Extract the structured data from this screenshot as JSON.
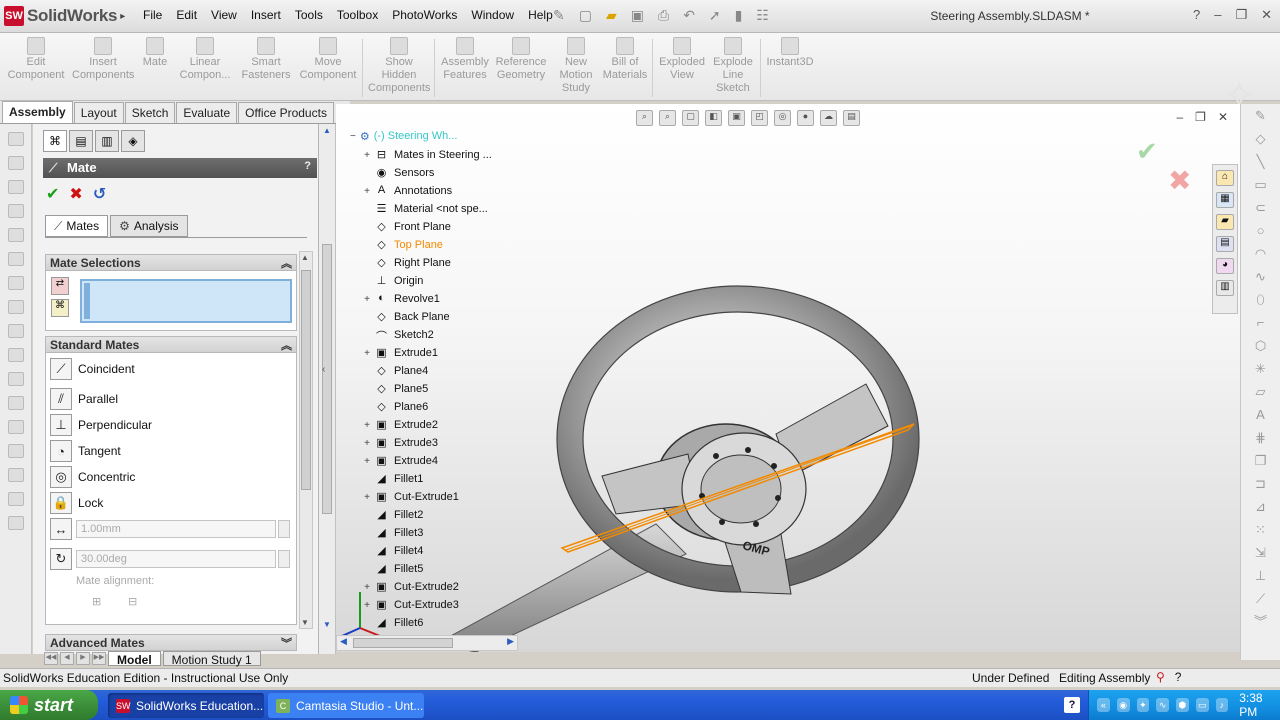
{
  "app": {
    "logo_text": "SolidWorks",
    "document_title": "Steering Assembly.SLDASM *"
  },
  "menu": [
    "File",
    "Edit",
    "View",
    "Insert",
    "Tools",
    "Toolbox",
    "PhotoWorks",
    "Window",
    "Help"
  ],
  "command_manager": [
    {
      "label": "Edit Component",
      "icon": "edit-component-icon"
    },
    {
      "label": "Insert Components",
      "icon": "insert-components-icon"
    },
    {
      "label": "Mate",
      "icon": "mate-icon"
    },
    {
      "label": "Linear Compon...",
      "icon": "linear-pattern-icon"
    },
    {
      "label": "Smart Fasteners",
      "icon": "smart-fasteners-icon"
    },
    {
      "label": "Move Component",
      "icon": "move-component-icon"
    },
    {
      "label": "Show Hidden Components",
      "icon": "show-hidden-icon"
    },
    {
      "label": "Assembly Features",
      "icon": "assembly-features-icon"
    },
    {
      "label": "Reference Geometry",
      "icon": "reference-geometry-icon"
    },
    {
      "label": "New Motion Study",
      "icon": "motion-study-icon"
    },
    {
      "label": "Bill of Materials",
      "icon": "bom-icon"
    },
    {
      "label": "Exploded View",
      "icon": "exploded-view-icon"
    },
    {
      "label": "Explode Line Sketch",
      "icon": "explode-line-icon"
    },
    {
      "label": "Instant3D",
      "icon": "instant3d-icon"
    }
  ],
  "cm_tabs": [
    {
      "label": "Assembly",
      "active": true
    },
    {
      "label": "Layout",
      "active": false
    },
    {
      "label": "Sketch",
      "active": false
    },
    {
      "label": "Evaluate",
      "active": false
    },
    {
      "label": "Office Products",
      "active": false
    }
  ],
  "property_manager": {
    "title": "Mate",
    "help_glyph": "?",
    "tabs": [
      {
        "label": "Mates",
        "icon": "mates-icon",
        "active": true
      },
      {
        "label": "Analysis",
        "icon": "analysis-icon",
        "active": false
      }
    ],
    "mate_selections_label": "Mate Selections",
    "standard_mates_label": "Standard Mates",
    "standard_mates": [
      {
        "label": "Coincident",
        "glyph": "⟋",
        "icon": "coincident-icon"
      },
      {
        "label": "Parallel",
        "glyph": "⫽",
        "icon": "parallel-icon"
      },
      {
        "label": "Perpendicular",
        "glyph": "⊥",
        "icon": "perpendicular-icon"
      },
      {
        "label": "Tangent",
        "glyph": "◔",
        "icon": "tangent-icon"
      },
      {
        "label": "Concentric",
        "glyph": "◎",
        "icon": "concentric-icon"
      },
      {
        "label": "Lock",
        "glyph": "🔒",
        "icon": "lock-icon"
      }
    ],
    "distance_value": "1.00mm",
    "angle_value": "30.00deg",
    "mate_alignment_label": "Mate alignment:",
    "advanced_mates_label": "Advanced Mates"
  },
  "bottom_tabs": [
    {
      "label": "Model",
      "active": true
    },
    {
      "label": "Motion Study 1",
      "active": false
    }
  ],
  "feature_tree": {
    "root_label": "(-) Steering Wh...",
    "items": [
      {
        "label": "Mates in Steering ...",
        "expand": "+",
        "icon": "mates-folder-icon",
        "glyph": "⊟",
        "highlight": false
      },
      {
        "label": "Sensors",
        "expand": "",
        "icon": "sensors-icon",
        "glyph": "◉",
        "highlight": false
      },
      {
        "label": "Annotations",
        "expand": "+",
        "icon": "annotations-icon",
        "glyph": "A",
        "highlight": false
      },
      {
        "label": "Material <not spe...",
        "expand": "",
        "icon": "material-icon",
        "glyph": "☰",
        "highlight": false
      },
      {
        "label": "Front Plane",
        "expand": "",
        "icon": "plane-icon",
        "glyph": "◇",
        "highlight": false
      },
      {
        "label": "Top Plane",
        "expand": "",
        "icon": "plane-icon",
        "glyph": "◇",
        "highlight": true
      },
      {
        "label": "Right Plane",
        "expand": "",
        "icon": "plane-icon",
        "glyph": "◇",
        "highlight": false
      },
      {
        "label": "Origin",
        "expand": "",
        "icon": "origin-icon",
        "glyph": "⊥",
        "highlight": false
      },
      {
        "label": "Revolve1",
        "expand": "+",
        "icon": "revolve-icon",
        "glyph": "◐",
        "highlight": false
      },
      {
        "label": "Back Plane",
        "expand": "",
        "icon": "plane-icon",
        "glyph": "◇",
        "highlight": false
      },
      {
        "label": "Sketch2",
        "expand": "",
        "icon": "sketch-icon",
        "glyph": "⌒",
        "highlight": false
      },
      {
        "label": "Extrude1",
        "expand": "+",
        "icon": "extrude-icon",
        "glyph": "▣",
        "highlight": false
      },
      {
        "label": "Plane4",
        "expand": "",
        "icon": "plane-icon",
        "glyph": "◇",
        "highlight": false
      },
      {
        "label": "Plane5",
        "expand": "",
        "icon": "plane-icon",
        "glyph": "◇",
        "highlight": false
      },
      {
        "label": "Plane6",
        "expand": "",
        "icon": "plane-icon",
        "glyph": "◇",
        "highlight": false
      },
      {
        "label": "Extrude2",
        "expand": "+",
        "icon": "extrude-icon",
        "glyph": "▣",
        "highlight": false
      },
      {
        "label": "Extrude3",
        "expand": "+",
        "icon": "extrude-icon",
        "glyph": "▣",
        "highlight": false
      },
      {
        "label": "Extrude4",
        "expand": "+",
        "icon": "extrude-icon",
        "glyph": "▣",
        "highlight": false
      },
      {
        "label": "Fillet1",
        "expand": "",
        "icon": "fillet-icon",
        "glyph": "◢",
        "highlight": false
      },
      {
        "label": "Cut-Extrude1",
        "expand": "+",
        "icon": "cut-extrude-icon",
        "glyph": "▣",
        "highlight": false
      },
      {
        "label": "Fillet2",
        "expand": "",
        "icon": "fillet-icon",
        "glyph": "◢",
        "highlight": false
      },
      {
        "label": "Fillet3",
        "expand": "",
        "icon": "fillet-icon",
        "glyph": "◢",
        "highlight": false
      },
      {
        "label": "Fillet4",
        "expand": "",
        "icon": "fillet-icon",
        "glyph": "◢",
        "highlight": false
      },
      {
        "label": "Fillet5",
        "expand": "",
        "icon": "fillet-icon",
        "glyph": "◢",
        "highlight": false
      },
      {
        "label": "Cut-Extrude2",
        "expand": "+",
        "icon": "cut-extrude-icon",
        "glyph": "▣",
        "highlight": false
      },
      {
        "label": "Cut-Extrude3",
        "expand": "+",
        "icon": "cut-extrude-icon",
        "glyph": "▣",
        "highlight": false
      },
      {
        "label": "Fillet6",
        "expand": "",
        "icon": "fillet-icon",
        "glyph": "◢",
        "highlight": false
      }
    ]
  },
  "wheel_logo_text": "OMP",
  "status_bar": {
    "edition": "SolidWorks Education Edition - Instructional Use Only",
    "definition": "Under Defined",
    "mode": "Editing Assembly"
  },
  "taskbar": {
    "start_label": "start",
    "buttons": [
      {
        "label": "SolidWorks Education...",
        "icon": "solidworks-app-icon",
        "active": true
      },
      {
        "label": "Camtasia Studio - Unt...",
        "icon": "camtasia-app-icon",
        "active": false
      }
    ],
    "clock": "3:38 PM"
  },
  "colors": {
    "accent_red": "#c8102e",
    "highlight_orange": "#f28a00",
    "selection_blue": "#cfe6f8",
    "taskbar_blue": "#245edb",
    "start_green": "#3c8f3a"
  }
}
